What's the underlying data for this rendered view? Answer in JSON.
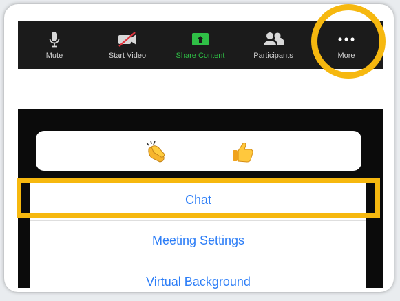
{
  "toolbar": {
    "items": [
      {
        "label": "Mute",
        "icon": "microphone-icon"
      },
      {
        "label": "Start Video",
        "icon": "video-off-icon"
      },
      {
        "label": "Share Content",
        "icon": "share-screen-icon",
        "color": "#2fbf46"
      },
      {
        "label": "Participants",
        "icon": "participants-icon"
      },
      {
        "label": "More",
        "icon": "more-dots-icon"
      }
    ]
  },
  "reactions": [
    {
      "icon": "clapping-hands-icon",
      "glyph": "👏"
    },
    {
      "icon": "thumbs-up-icon",
      "glyph": "👍"
    }
  ],
  "menu": {
    "items": [
      {
        "label": "Chat"
      },
      {
        "label": "Meeting Settings"
      },
      {
        "label": "Virtual Background"
      }
    ]
  },
  "colors": {
    "highlight": "#f6b80f",
    "menu_text": "#2d7ef7",
    "toolbar_bg": "#1b1b1b"
  }
}
